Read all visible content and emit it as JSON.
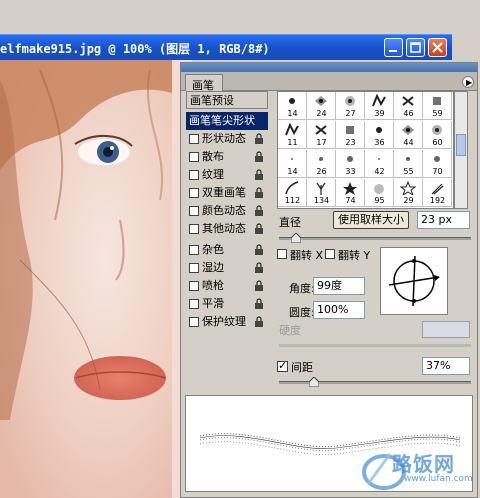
{
  "document": {
    "title": "elfmake915.jpg @ 100% (图层 1, RGB/8#)"
  },
  "panel": {
    "tab_label": "画笔",
    "options": [
      {
        "label": "画笔预设",
        "kind": "header"
      },
      {
        "label": "画笔笔尖形状",
        "kind": "selected"
      },
      {
        "label": "形状动态",
        "kind": "check",
        "locked": true
      },
      {
        "label": "散布",
        "kind": "check",
        "locked": true
      },
      {
        "label": "纹理",
        "kind": "check",
        "locked": true
      },
      {
        "label": "双重画笔",
        "kind": "check",
        "locked": true
      },
      {
        "label": "颜色动态",
        "kind": "check",
        "locked": true
      },
      {
        "label": "其他动态",
        "kind": "check",
        "locked": true
      },
      {
        "label": "杂色",
        "kind": "check",
        "locked": true
      },
      {
        "label": "湿边",
        "kind": "check",
        "locked": true
      },
      {
        "label": "喷枪",
        "kind": "check",
        "locked": true
      },
      {
        "label": "平滑",
        "kind": "check",
        "locked": true
      },
      {
        "label": "保护纹理",
        "kind": "check",
        "locked": true
      }
    ],
    "brush_sizes": [
      [
        "14",
        "24",
        "27",
        "39",
        "46",
        "59"
      ],
      [
        "11",
        "17",
        "23",
        "36",
        "44",
        "60"
      ],
      [
        "14",
        "26",
        "33",
        "42",
        "55",
        "70"
      ],
      [
        "112",
        "134",
        "74",
        "95",
        "29",
        "192"
      ]
    ],
    "diameter_label": "直径",
    "use_sample_size_label": "使用取样大小",
    "diameter_value": "23 px",
    "flip_x_label": "翻转 X",
    "flip_y_label": "翻转 Y",
    "angle_label": "角度:",
    "angle_value": "99度",
    "roundness_label": "圆度:",
    "roundness_value": "100%",
    "hardness_label": "硬度",
    "spacing_label": "间距",
    "spacing_checked": true,
    "spacing_value": "37%"
  },
  "watermark": {
    "text": "路饭网",
    "url": "www.lufan.com"
  }
}
